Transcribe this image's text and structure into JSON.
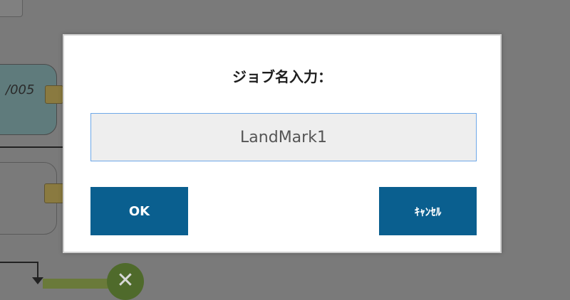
{
  "background": {
    "node1_label": "/005",
    "close_symbol": "✕"
  },
  "dialog": {
    "title": "ジョブ名入力：",
    "input_value": "LandMark1",
    "ok_label": "OK",
    "cancel_label": "ｷｬﾝｾﾙ"
  },
  "colors": {
    "overlay": "#7a7a7a",
    "button": "#0a5f8f",
    "input_border": "#6ea8e8",
    "input_bg": "#eeeeee"
  }
}
